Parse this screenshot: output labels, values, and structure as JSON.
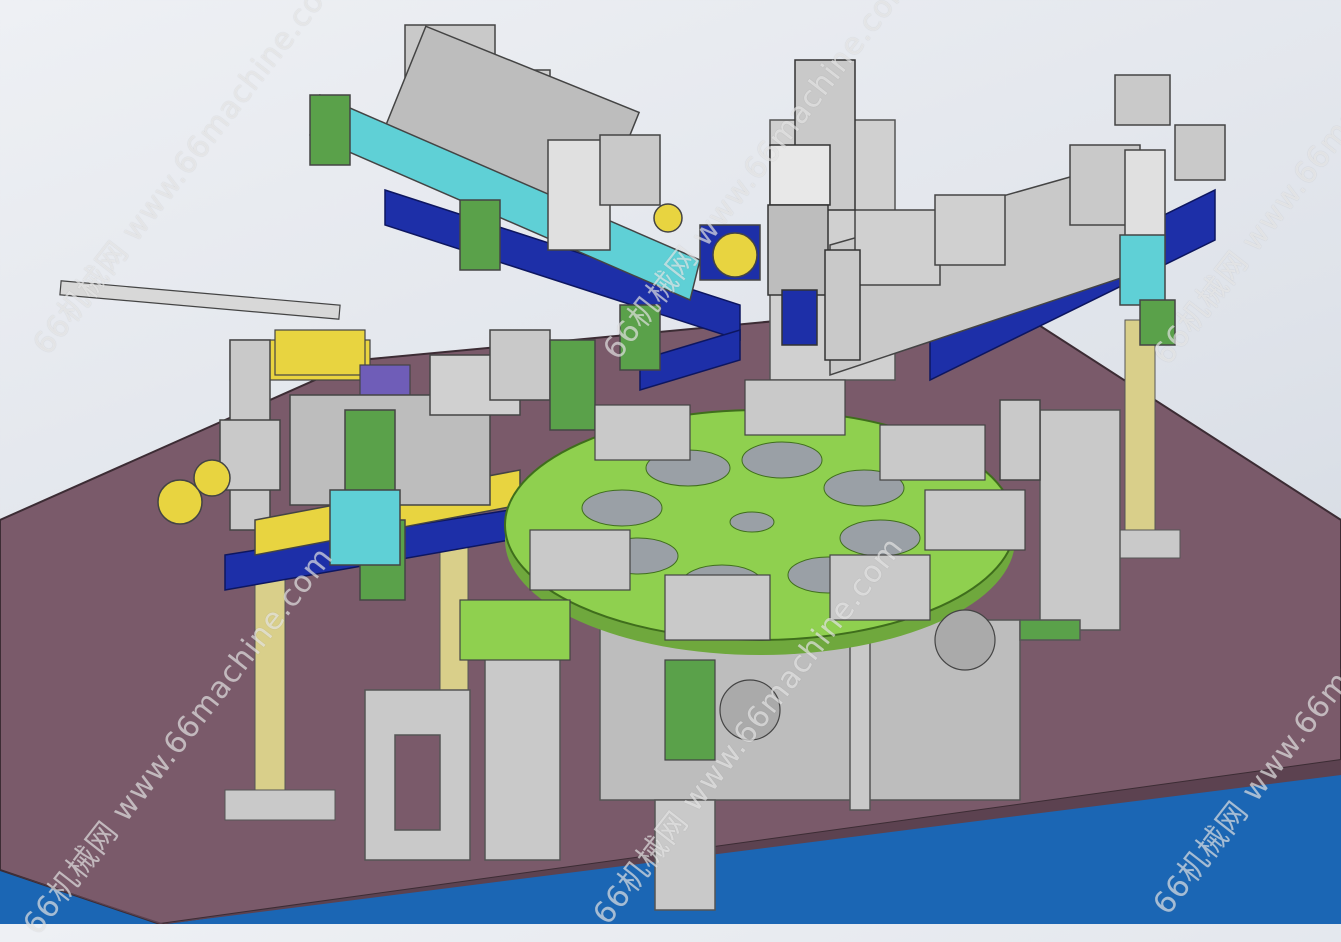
{
  "watermarks": [
    {
      "text": "66机械网 www.66machine.com"
    },
    {
      "text": "66机械网 www.66machine.com"
    },
    {
      "text": "66机械网 www.66machine.com"
    },
    {
      "text": "66机械网 www.66machine.com"
    },
    {
      "text": "66机械网 www.66machine.com"
    },
    {
      "text": "66机械网 www.66machine.com"
    }
  ],
  "colors": {
    "floor_blue": "#1b66b4",
    "base_plate": "#7a5a6a",
    "turntable": "#8fd04f",
    "steel": "#c9c9c9",
    "cyan": "#5fd0d6",
    "navy": "#1d2fa8",
    "yellow": "#e8d440",
    "cream": "#d9cf8a",
    "green_cyl": "#5aa14a",
    "purple": "#6f5db8"
  }
}
